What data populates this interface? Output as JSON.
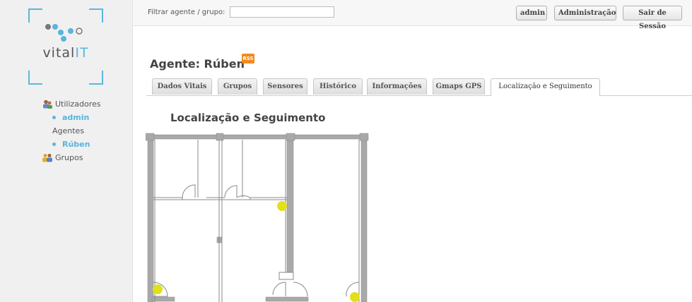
{
  "brand": {
    "vital": "vital",
    "it": "IT",
    "accent": "#58b5de"
  },
  "sidebar": {
    "items": [
      {
        "label": "Utilizadores",
        "icon": "users-icon"
      },
      {
        "label": "admin",
        "sub": true
      },
      {
        "label": "Agentes"
      },
      {
        "label": "Rúben",
        "sub": true
      },
      {
        "label": "Grupos",
        "icon": "groups-icon"
      }
    ]
  },
  "topbar": {
    "filter_label": "Filtrar agente / grupo:",
    "filter_value": "",
    "buttons": [
      "admin",
      "Administração",
      "Sair de Sessão"
    ]
  },
  "page": {
    "title": "Agente: Rúben",
    "rss": "RSS",
    "tabs": [
      "Dados Vitais",
      "Grupos",
      "Sensores",
      "Histórico",
      "Informações",
      "Gmaps GPS",
      "Localização e Seguimento"
    ],
    "active_tab": 6,
    "section_title": "Localização e Seguimento"
  },
  "floorplan": {
    "marker_color": "#e2e01a",
    "markers": 3
  }
}
